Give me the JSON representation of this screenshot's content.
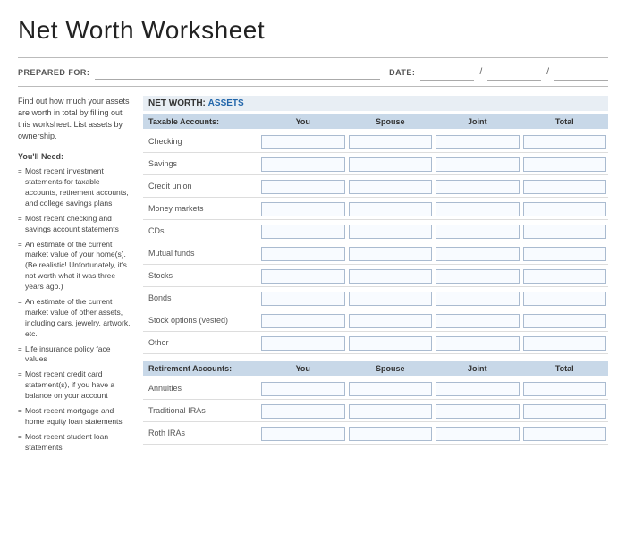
{
  "title": "Net Worth Worksheet",
  "prepared_label": "PREPARED FOR:",
  "date_label": "DATE:",
  "net_worth_label": "NET WORTH:",
  "assets_label": "ASSETS",
  "sidebar": {
    "intro": "Find out how much your assets are worth in total by filling out this worksheet. List assets by ownership.",
    "need_title": "You'll Need:",
    "items": [
      "Most recent investment statements for taxable accounts, retirement accounts, and college savings plans",
      "Most recent checking and savings account statements",
      "An estimate of the current market value of your home(s). (Be realistic! Unfortunately, it's not worth what it was three years ago.)",
      "An estimate of the current market value of other assets, including cars, jewelry, artwork, etc.",
      "Life insurance policy face values",
      "Most recent credit card statement(s), if you have a balance on your account",
      "Most recent mortgage and home equity loan statements",
      "Most recent student loan statements"
    ]
  },
  "taxable_accounts": {
    "label": "Taxable Accounts:",
    "columns": [
      "You",
      "Spouse",
      "Joint",
      "Total"
    ],
    "rows": [
      "Checking",
      "Savings",
      "Credit union",
      "Money markets",
      "CDs",
      "Mutual funds",
      "Stocks",
      "Bonds",
      "Stock options (vested)",
      "Other"
    ]
  },
  "retirement_accounts": {
    "label": "Retirement Accounts:",
    "columns": [
      "You",
      "Spouse",
      "Joint",
      "Total"
    ],
    "rows": [
      "Annuities",
      "Traditional IRAs",
      "Roth IRAs"
    ]
  }
}
